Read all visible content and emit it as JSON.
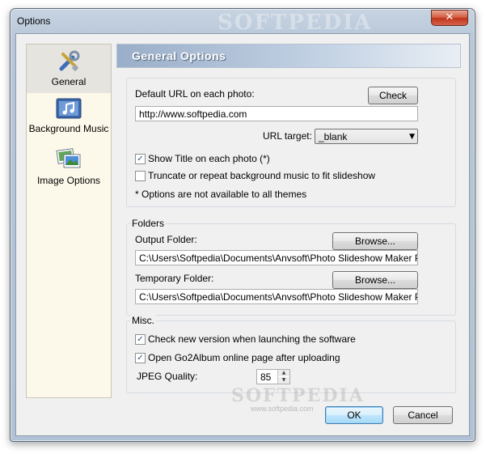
{
  "window": {
    "title": "Options",
    "close_glyph": "✕",
    "watermark": "SOFTPEDIA"
  },
  "sidebar": {
    "items": [
      {
        "label": "General",
        "icon": "tools-icon"
      },
      {
        "label": "Background Music",
        "icon": "music-icon"
      },
      {
        "label": "Image Options",
        "icon": "images-icon"
      }
    ]
  },
  "header": {
    "title": "General Options"
  },
  "general": {
    "default_url_label": "Default URL on each photo:",
    "check_button": "Check",
    "url_value": "http://www.softpedia.com",
    "url_target_label": "URL target:",
    "url_target_value": "_blank",
    "show_title_label": "Show Title on each photo (*)",
    "show_title_checked": true,
    "truncate_label": "Truncate or repeat background music to fit slideshow",
    "truncate_checked": false,
    "note": "* Options are not available to all themes"
  },
  "folders": {
    "legend": "Folders",
    "output_label": "Output Folder:",
    "output_browse": "Browse...",
    "output_path": "C:\\Users\\Softpedia\\Documents\\Anvsoft\\Photo Slideshow Maker Platinum",
    "temp_label": "Temporary Folder:",
    "temp_browse": "Browse...",
    "temp_path": "C:\\Users\\Softpedia\\Documents\\Anvsoft\\Photo Slideshow Maker Platinum"
  },
  "misc": {
    "legend": "Misc.",
    "check_version_label": "Check new version when launching the software",
    "check_version_checked": true,
    "open_go2album_label": "Open Go2Album online page after uploading",
    "open_go2album_checked": true,
    "jpeg_label": "JPEG Quality:",
    "jpeg_value": "85",
    "watermark": "SOFTPEDIA",
    "watermark_url": "www.softpedia.com"
  },
  "footer": {
    "ok": "OK",
    "cancel": "Cancel"
  },
  "check_glyph": "✓"
}
